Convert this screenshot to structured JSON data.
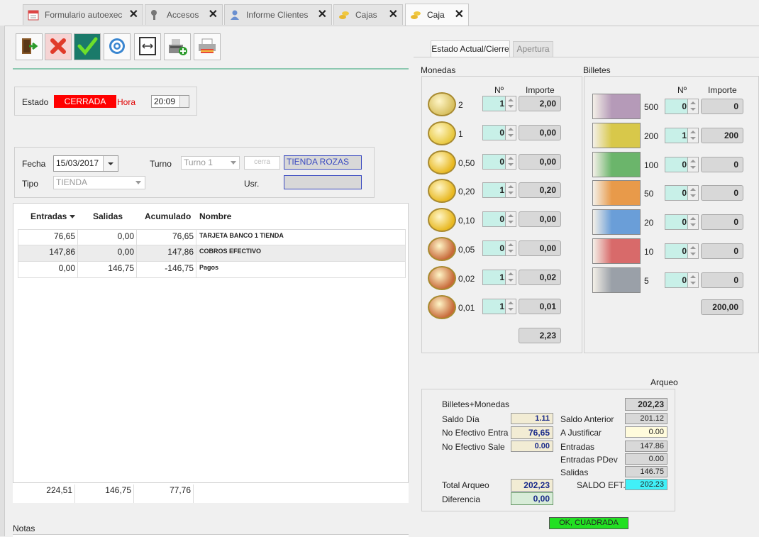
{
  "tabs": [
    {
      "label": "Formulario autoexec",
      "icon": "calendar-icon"
    },
    {
      "label": "Accesos",
      "icon": "key-icon"
    },
    {
      "label": "Informe Clientes",
      "icon": "user-icon"
    },
    {
      "label": "Cajas",
      "icon": "coins-icon"
    },
    {
      "label": "Caja",
      "icon": "coins-icon"
    }
  ],
  "toolbar": [
    "exit-icon",
    "cancel-icon",
    "accept-icon",
    "settings-icon",
    "resize-icon",
    "cash-register-icon",
    "printer-icon"
  ],
  "estado": {
    "label": "Estado",
    "value": "CERRADA",
    "hora_label": "Hora",
    "hora": "20:09",
    "status_color": "#ff0000"
  },
  "filtros": {
    "fecha_label": "Fecha",
    "fecha": "15/03/2017",
    "turno_label": "Turno",
    "turno": "Turno 1",
    "turno_extra": "cerra",
    "tienda": "TIENDA ROZAS",
    "tipo_label": "Tipo",
    "tipo": "TIENDA",
    "usr_label": "Usr.",
    "usr": ""
  },
  "grid": {
    "headers": [
      "Entradas",
      "Salidas",
      "Acumulado",
      "Nombre"
    ],
    "rows": [
      {
        "entradas": "76,65",
        "salidas": "0,00",
        "acumulado": "76,65",
        "nombre": "TARJETA BANCO 1 TIENDA"
      },
      {
        "entradas": "147,86",
        "salidas": "0,00",
        "acumulado": "147,86",
        "nombre": "COBROS EFECTIVO"
      },
      {
        "entradas": "0,00",
        "salidas": "146,75",
        "acumulado": "-146,75",
        "nombre": "Pagos"
      }
    ],
    "totals": {
      "entradas": "224,51",
      "salidas": "146,75",
      "acumulado": "77,76"
    }
  },
  "notas_label": "Notas",
  "right_tabs": [
    "Estado Actual/Cierre",
    "Apertura"
  ],
  "monedas": {
    "title": "Monedas",
    "n_header": "Nº",
    "importe_header": "Importe",
    "rows": [
      {
        "denom": "2",
        "n": "1",
        "importe": "2,00"
      },
      {
        "denom": "1",
        "n": "0",
        "importe": "0,00"
      },
      {
        "denom": "0,50",
        "n": "0",
        "importe": "0,00"
      },
      {
        "denom": "0,20",
        "n": "1",
        "importe": "0,20"
      },
      {
        "denom": "0,10",
        "n": "0",
        "importe": "0,00"
      },
      {
        "denom": "0,05",
        "n": "0",
        "importe": "0,00"
      },
      {
        "denom": "0,02",
        "n": "1",
        "importe": "0,02"
      },
      {
        "denom": "0,01",
        "n": "1",
        "importe": "0,01"
      }
    ],
    "total": "2,23"
  },
  "billetes": {
    "title": "Billetes",
    "n_header": "Nº",
    "importe_header": "Importe",
    "rows": [
      {
        "denom": "500",
        "n": "0",
        "importe": "0",
        "color": "#b59ab8"
      },
      {
        "denom": "200",
        "n": "1",
        "importe": "200",
        "color": "#d8c84a"
      },
      {
        "denom": "100",
        "n": "0",
        "importe": "0",
        "color": "#6bb56b"
      },
      {
        "denom": "50",
        "n": "0",
        "importe": "0",
        "color": "#e89a4a"
      },
      {
        "denom": "20",
        "n": "0",
        "importe": "0",
        "color": "#6a9ed8"
      },
      {
        "denom": "10",
        "n": "0",
        "importe": "0",
        "color": "#d86a6a"
      },
      {
        "denom": "5",
        "n": "0",
        "importe": "0",
        "color": "#9aa0a8"
      }
    ],
    "total": "200,00"
  },
  "arqueo": {
    "title": "Arqueo",
    "billetes_monedas_label": "Billetes+Monedas",
    "billetes_monedas": "202,23",
    "saldo_dia_label": "Saldo Día",
    "saldo_dia": "1.11",
    "saldo_anterior_label": "Saldo Anterior",
    "saldo_anterior": "201.12",
    "no_ef_entra_label": "No Efectivo Entra",
    "no_ef_entra": "76,65",
    "a_justificar_label": "A Justificar",
    "a_justificar": "0.00",
    "no_ef_sale_label": "No Efectivo Sale",
    "no_ef_sale": "0.00",
    "entradas_label": "Entradas",
    "entradas": "147.86",
    "entradas_pdev_label": "Entradas PDev",
    "entradas_pdev": "0.00",
    "salidas_label": "Salidas",
    "salidas": "146.75",
    "total_arqueo_label": "Total Arqueo",
    "total_arqueo": "202,23",
    "saldo_eft_label": "SALDO EFT...",
    "saldo_eft": "202.23",
    "diferencia_label": "Diferencia",
    "diferencia": "0,00",
    "status": "OK, CUADRADA"
  }
}
